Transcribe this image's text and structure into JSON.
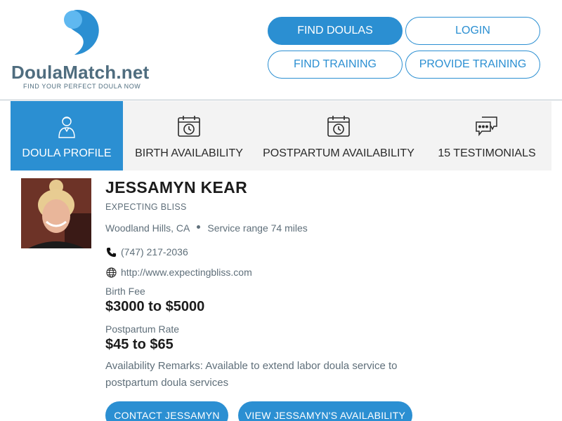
{
  "brand": {
    "name": "DoulaMatch.net",
    "tagline": "FIND YOUR PERFECT DOULA NOW",
    "colors": {
      "primary": "#2b8fd2",
      "light": "#5fb8f0",
      "text": "#4f6d7f"
    }
  },
  "nav": {
    "find_doulas": "FIND DOULAS",
    "login": "LOGIN",
    "find_training": "FIND TRAINING",
    "provide_training": "PROVIDE TRAINING"
  },
  "tabs": [
    {
      "label": "DOULA PROFILE",
      "icon": "doula-person-icon",
      "active": true
    },
    {
      "label": "BIRTH AVAILABILITY",
      "icon": "calendar-clock-icon",
      "active": false
    },
    {
      "label": "POSTPARTUM AVAILABILITY",
      "icon": "calendar-clock-icon",
      "active": false
    },
    {
      "label": "15 TESTIMONIALS",
      "icon": "chat-bubbles-icon",
      "active": false
    }
  ],
  "profile": {
    "name": "JESSAMYN KEAR",
    "business": "EXPECTING BLISS",
    "location": "Woodland Hills, CA",
    "service_range": "Service range 74 miles",
    "phone": "(747) 217-2036",
    "website": "http://www.expectingbliss.com",
    "birth_fee_label": "Birth Fee",
    "birth_fee": "$3000 to $5000",
    "postpartum_label": "Postpartum Rate",
    "postpartum_rate": "$45 to $65",
    "remarks": "Availability Remarks: Available to extend labor doula service to postpartum doula services"
  },
  "actions": {
    "contact": "CONTACT JESSAMYN",
    "availability": "VIEW JESSAMYN'S AVAILABILITY"
  }
}
